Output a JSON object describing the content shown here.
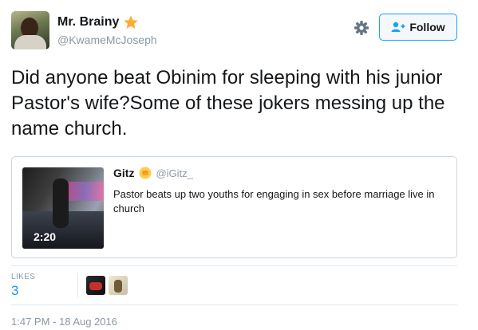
{
  "author": {
    "display_name": "Mr. Brainy",
    "handle": "@KwameMcJoseph",
    "badge_icon": "star-icon",
    "avatar_icon": "user-avatar"
  },
  "actions": {
    "settings_icon": "gear-icon",
    "follow_label": "Follow",
    "follow_icon": "add-user-icon"
  },
  "tweet": {
    "text": "Did anyone beat Obinim for sleeping with his junior Pastor's wife?Some of these jokers messing up the name church."
  },
  "quoted_tweet": {
    "name": "Gitz",
    "emoji_icon": "raised-fist-icon",
    "handle": "@iGitz_",
    "text": "Pastor beats up two youths for engaging in sex before marriage live in church",
    "video_duration": "2:20"
  },
  "stats": {
    "likes_label": "LIKES",
    "likes_count": "3"
  },
  "footer": {
    "timestamp": "1:47 PM - 18 Aug 2016"
  },
  "colors": {
    "accent": "#1da1f2",
    "link": "#1b95e0",
    "muted": "#8899a6",
    "star": "#ffac33"
  }
}
